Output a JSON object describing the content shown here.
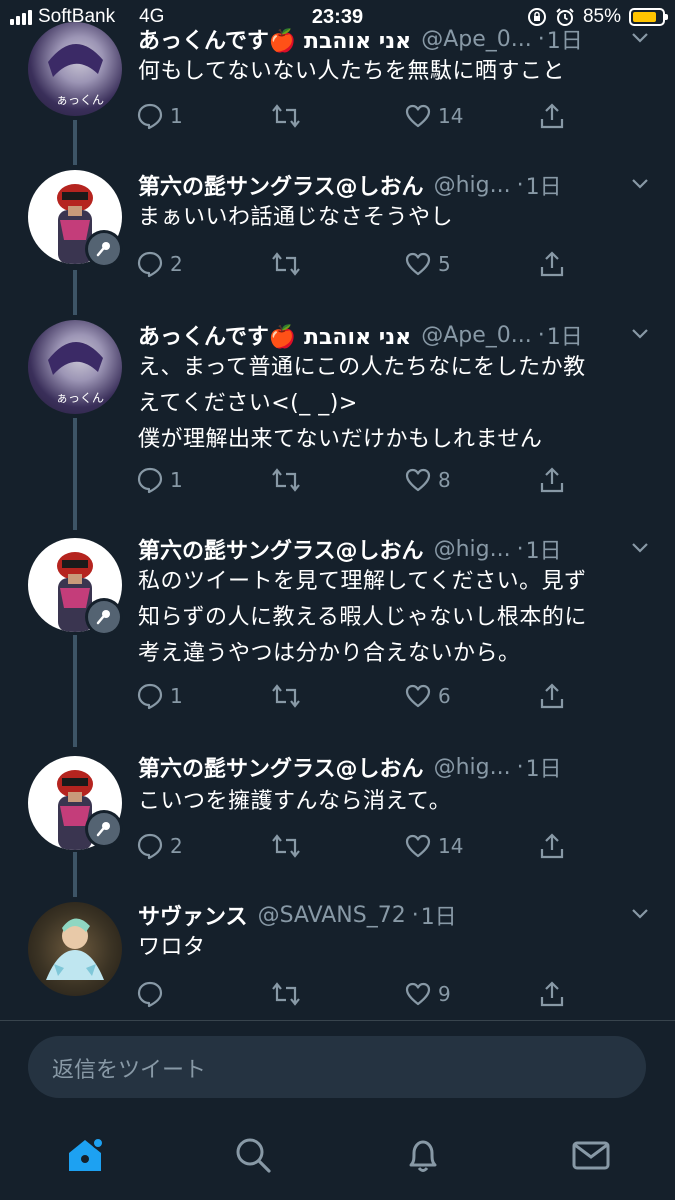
{
  "status_bar": {
    "carrier": "SoftBank",
    "network": "4G",
    "time": "23:39",
    "battery_percent": "85%",
    "battery_level": 0.85
  },
  "tweets": [
    {
      "name": "あっくんです🍎 אני אוהבת",
      "handle": "@Ape_0...",
      "time": "1日",
      "text": "何もしてないない人たちを無駄に晒すこと",
      "replies": "1",
      "retweets": "",
      "likes": "14"
    },
    {
      "name": "第六の髭サングラス@しおん",
      "handle": "@hig...",
      "time": "1日",
      "text": "まぁいいわ話通じなさそうやし",
      "replies": "2",
      "retweets": "",
      "likes": "5"
    },
    {
      "name": "あっくんです🍎 אני אוהבת",
      "handle": "@Ape_0...",
      "time": "1日",
      "text": "え、まって普通にこの人たちなにをしたか教\nえてください<(_ _)>\n僕が理解出来てないだけかもしれません",
      "replies": "1",
      "retweets": "",
      "likes": "8"
    },
    {
      "name": "第六の髭サングラス@しおん",
      "handle": "@hig...",
      "time": "1日",
      "text": "私のツイートを見て理解してください。見ず\n知らずの人に教える暇人じゃないし根本的に\n考え違うやつは分かり合えないから。",
      "replies": "1",
      "retweets": "",
      "likes": "6"
    },
    {
      "name": "第六の髭サングラス@しおん",
      "handle": "@hig...",
      "time": "1日",
      "text": "こいつを擁護すんなら消えて。",
      "replies": "2",
      "retweets": "",
      "likes": "14"
    },
    {
      "name": "サヴァンス",
      "handle": "@SAVANS_72",
      "time": "1日",
      "text": "ワロタ",
      "replies": "",
      "retweets": "",
      "likes": "9"
    }
  ],
  "reply_bar": {
    "placeholder": "返信をツイート"
  },
  "tab_bar": {
    "tabs": [
      "home-icon",
      "search-icon",
      "notifications-icon",
      "messages-icon"
    ],
    "active": "home-icon"
  },
  "colors": {
    "background": "#15202b",
    "accent": "#1da1f2",
    "secondary_text": "#8899a6",
    "battery": "#ffc400"
  }
}
